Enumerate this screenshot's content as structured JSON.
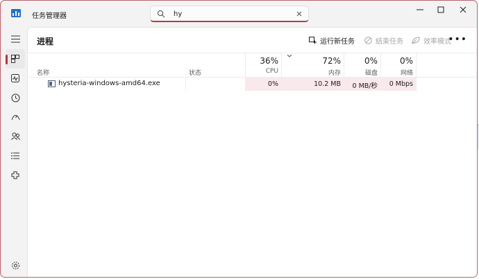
{
  "app": {
    "title": "任务管理器",
    "icon": "task-manager-logo-icon"
  },
  "search": {
    "value": "hy",
    "placeholder": ""
  },
  "window_controls": {
    "minimize": "minimize-icon",
    "maximize": "maximize-icon",
    "close": "close-icon"
  },
  "sidebar": {
    "items": [
      {
        "name": "hamburger-menu-icon"
      },
      {
        "name": "processes-icon",
        "active": true
      },
      {
        "name": "performance-icon"
      },
      {
        "name": "app-history-icon"
      },
      {
        "name": "startup-apps-icon"
      },
      {
        "name": "users-icon"
      },
      {
        "name": "details-icon"
      },
      {
        "name": "services-icon"
      },
      {
        "name": "settings-icon"
      }
    ]
  },
  "page": {
    "title": "进程",
    "actions": {
      "run_new_task": "运行新任务",
      "end_task": "结束任务",
      "efficiency_mode": "效率模式"
    },
    "more": "•••"
  },
  "columns": {
    "name": "名称",
    "status": "状态",
    "cpu": {
      "pct": "36%",
      "label": "CPU"
    },
    "memory": {
      "pct": "72%",
      "label": "内存"
    },
    "disk": {
      "pct": "0%",
      "label": "磁盘"
    },
    "network": {
      "pct": "0%",
      "label": "网络"
    }
  },
  "rows": [
    {
      "name": "hysteria-windows-amd64.exe",
      "status": "",
      "cpu": "0%",
      "memory": "10.2 MB",
      "disk": "0 MB/秒",
      "network": "0 Mbps"
    }
  ],
  "colors": {
    "accent": "#b4323f",
    "highlight": "#f9e8ec"
  }
}
